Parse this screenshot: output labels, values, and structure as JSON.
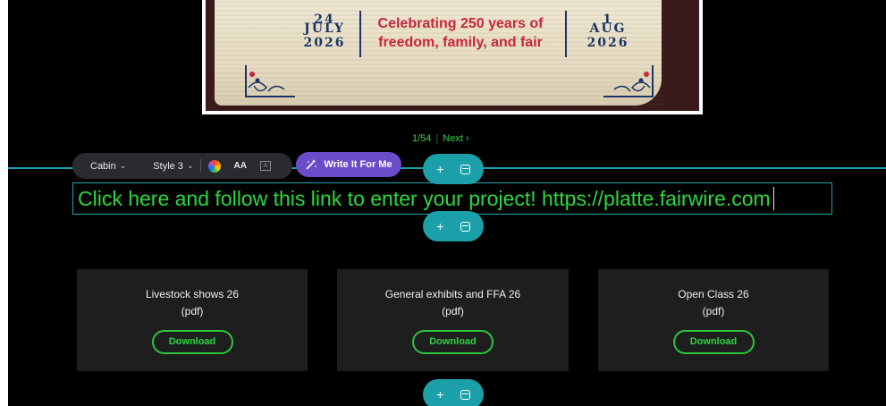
{
  "poster": {
    "left_day": "24",
    "left_month": "JULY",
    "left_year": "2026",
    "tagline_line1": "Celebrating 250 years of",
    "tagline_line2": "freedom, family, and fair",
    "right_day": "1",
    "right_month": "AUG",
    "right_year": "2026"
  },
  "pager": {
    "current": "1/54",
    "separator": "|",
    "next_label": "Next ›"
  },
  "toolbar": {
    "font": "Cabin",
    "style": "Style 3",
    "aa_label": "AA",
    "write_label": "Write It For Me",
    "colors": {
      "bar": "#2b2b2f",
      "write": "#6a4bc9",
      "accent": "#1ba3ad"
    }
  },
  "pills": {
    "add_symbol": "+"
  },
  "link_text": "Click here and follow this link to enter your project!  https://platte.fairwire.com",
  "cards": [
    {
      "title": "Livestock shows 26",
      "sub": "(pdf)",
      "button": "Download"
    },
    {
      "title": "General exhibits and FFA 26",
      "sub": "(pdf)",
      "button": "Download"
    },
    {
      "title": "Open Class 26",
      "sub": "(pdf)",
      "button": "Download"
    }
  ]
}
